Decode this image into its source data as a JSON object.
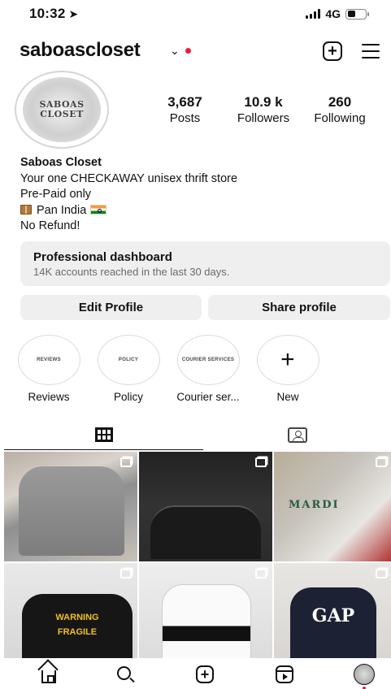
{
  "status_bar": {
    "time": "10:32",
    "network": "4G",
    "battery_level": 0.45,
    "icons": [
      "location-arrow-icon",
      "signal-icon",
      "battery-icon"
    ]
  },
  "header": {
    "username": "saboascloset",
    "chevron": "⌄",
    "add_icon": "+",
    "notification_color": "#ed1c3c"
  },
  "profile": {
    "avatar_text": "SABOAS\nCLOSET",
    "stats": [
      {
        "value": "3,687",
        "label": "Posts"
      },
      {
        "value": "10.9 k",
        "label": "Followers"
      },
      {
        "value": "260",
        "label": "Following"
      }
    ],
    "bio": {
      "name": "Saboas Closet",
      "line1": "Your one CHECKAWAY unisex thrift store",
      "line2": "Pre-Paid only",
      "line3": "Pan India",
      "line4": "No Refund!"
    }
  },
  "dashboard": {
    "title": "Professional dashboard",
    "subtitle": "14K accounts reached in the last 30 days."
  },
  "buttons": {
    "edit": "Edit Profile",
    "share": "Share profile"
  },
  "highlights": [
    {
      "cover": "REVIEWS",
      "label": "Reviews"
    },
    {
      "cover": "POLICY",
      "label": "Policy"
    },
    {
      "cover": "COURIER SERVICES",
      "label": "Courier ser..."
    },
    {
      "cover": "+",
      "label": "New"
    }
  ],
  "tabs": {
    "grid_icon": "grid-icon",
    "tagged_icon": "tagged-icon"
  },
  "posts": {
    "p3_text": "MARDI",
    "p4_text": "WARNING FRAGILE",
    "p6_text": "GAP"
  },
  "bottom_nav": {
    "items": [
      "home-icon",
      "search-icon",
      "create-icon",
      "reels-icon",
      "profile-avatar"
    ],
    "create_label": "+"
  },
  "colors": {
    "accent_red": "#ed1c3c",
    "button_bg": "#efefef",
    "secondary_text": "#6b6b6b"
  }
}
